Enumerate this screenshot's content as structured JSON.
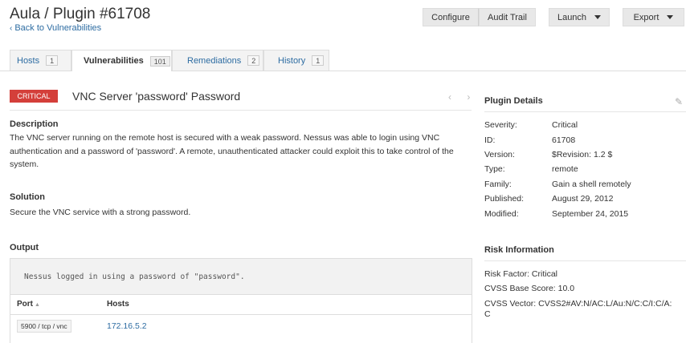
{
  "header": {
    "title": "Aula / Plugin #61708",
    "back_link": "Back to Vulnerabilities"
  },
  "toolbar": {
    "configure": "Configure",
    "audit_trail": "Audit Trail",
    "launch": "Launch",
    "export": "Export"
  },
  "tabs": [
    {
      "label": "Hosts",
      "count": "1"
    },
    {
      "label": "Vulnerabilities",
      "count": "101"
    },
    {
      "label": "Remediations",
      "count": "2"
    },
    {
      "label": "History",
      "count": "1"
    }
  ],
  "vulnerability": {
    "severity_badge": "CRITICAL",
    "name": "VNC Server 'password' Password",
    "nav": "‹ ›"
  },
  "description": {
    "title": "Description",
    "text": "The VNC server running on the remote host is secured with a weak password. Nessus was able to login using VNC authentication and a password of 'password'. A remote, unauthenticated attacker could exploit this to take control of the system."
  },
  "solution": {
    "title": "Solution",
    "text": "Secure the VNC service with a strong password."
  },
  "output": {
    "title": "Output",
    "text": "Nessus logged in using a password of \"password\".",
    "port_header": "Port",
    "hosts_header": "Hosts",
    "sort_indicator": "▲",
    "rows": [
      {
        "port": "5900 / tcp / vnc",
        "host": "172.16.5.2"
      }
    ]
  },
  "plugin_details": {
    "title": "Plugin Details",
    "items": [
      {
        "label": "Severity:",
        "value": "Critical"
      },
      {
        "label": "ID:",
        "value": "61708"
      },
      {
        "label": "Version:",
        "value": "$Revision: 1.2 $"
      },
      {
        "label": "Type:",
        "value": "remote"
      },
      {
        "label": "Family:",
        "value": "Gain a shell remotely"
      },
      {
        "label": "Published:",
        "value": "August 29, 2012"
      },
      {
        "label": "Modified:",
        "value": "September 24, 2015"
      }
    ]
  },
  "risk_information": {
    "title": "Risk Information",
    "risk_factor": "Risk Factor: Critical",
    "cvss_base_score": "CVSS Base Score: 10.0",
    "cvss_vector": "CVSS Vector: CVSS2#AV:N/AC:L/Au:N/C:C/I:C/A:C"
  },
  "colors": {
    "critical": "#d43f3a",
    "link": "#2d6ca2"
  }
}
